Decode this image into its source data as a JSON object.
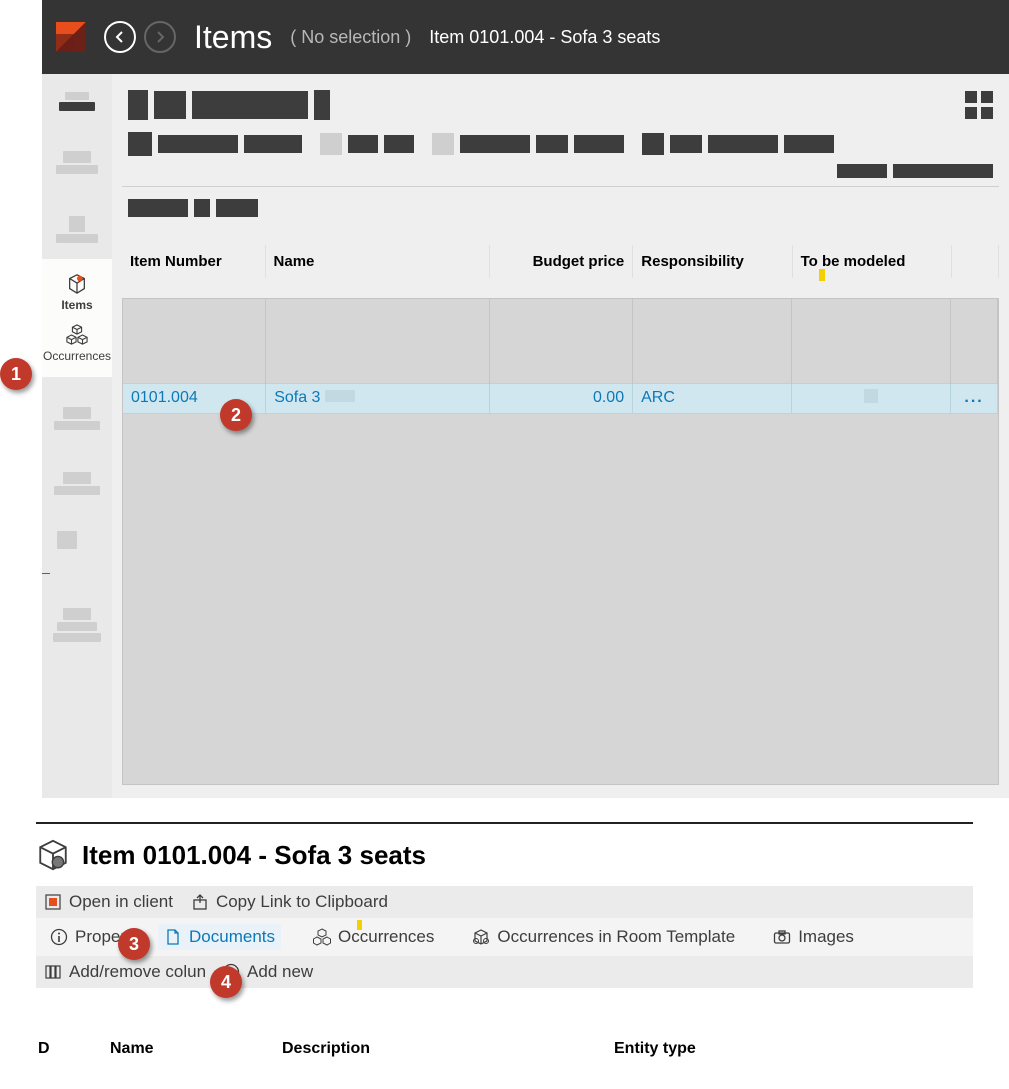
{
  "header": {
    "title": "Items",
    "subtitle": "( No selection )",
    "path": "Item 0101.004 - Sofa 3 seats"
  },
  "sidebar": {
    "items_label": "Items",
    "occurrences_label": "Occurrences"
  },
  "table": {
    "headers": {
      "item_number": "Item Number",
      "name": "Name",
      "budget_price": "Budget price",
      "responsibility": "Responsibility",
      "to_be_modeled": "To be modeled"
    },
    "row": {
      "item_number": "0101.004",
      "name": "Sofa 3",
      "budget_price": "0.00",
      "responsibility": "ARC",
      "actions": "..."
    }
  },
  "callouts": {
    "1": "1",
    "2": "2",
    "3": "3",
    "4": "4"
  },
  "detail": {
    "title": "Item 0101.004 - Sofa 3 seats",
    "actions": {
      "open_in_client": "Open in client",
      "copy_link": "Copy Link to Clipboard"
    },
    "tabs": {
      "properties": "Proper",
      "documents": "Documents",
      "occurrences": "Occurrences",
      "occurrences_in_room_template": "Occurrences in Room Template",
      "images": "Images"
    },
    "sub_actions": {
      "add_remove_columns": "Add/remove colun",
      "add_new": "Add new"
    },
    "table_headers": {
      "d": "D",
      "name": "Name",
      "description": "Description",
      "entity_type": "Entity type"
    }
  }
}
